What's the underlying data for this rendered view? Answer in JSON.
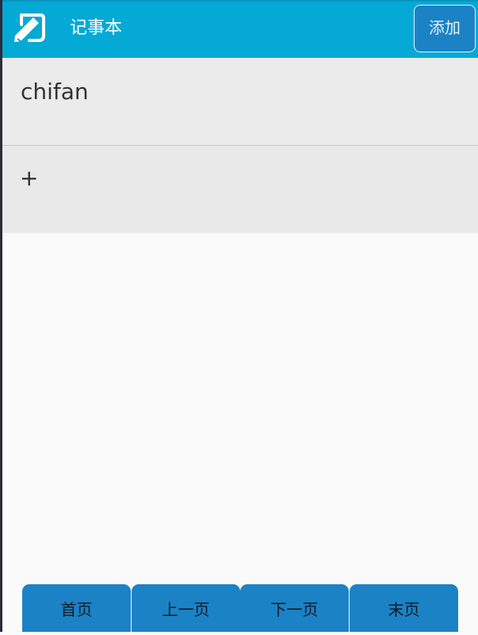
{
  "app": {
    "title": "记事本",
    "icon": "notepad-pencil-icon",
    "colors": {
      "appbar": "#05a9d6",
      "button": "#1b82c5",
      "list_item": "#ecebec",
      "background": "#fafafa"
    }
  },
  "toolbar": {
    "add_label": "添加"
  },
  "notes": [
    {
      "text": "chifan"
    }
  ],
  "add_row": {
    "label": "+"
  },
  "pager": {
    "first": "首页",
    "prev": "上一页",
    "next": "下一页",
    "last": "末页"
  }
}
